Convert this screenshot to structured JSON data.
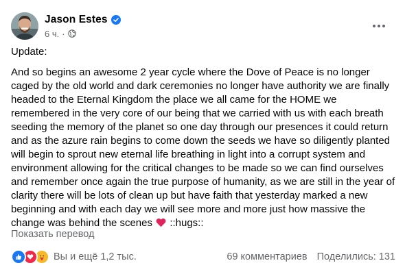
{
  "post": {
    "author": "Jason Estes",
    "time": "6 ч.",
    "separator": "·",
    "update_label": "Update:",
    "body_before_heart": "And so begins an awesome 2 year cycle where the Dove of Peace is no longer caged by the old world and dark ceremonies no longer have authority we are finally headed to the Eternal Kingdom the place we all came for the HOME we remembered in the very core of our being that we carried with us with each breath seeding the memory of the planet so one day through our presences it could return and as the azure rain begins to come down the seeds we have so diligently planted will begin to sprout new eternal life breathing in light into a corrupt system and environment allowing for the critical changes to be made so we can find ourselves and remember once again the true purpose of humanity, as we are still in the year of clarity there will be lots of clean up but have faith that yesterday marked a new beginning and with each day we will see more and more just how massive the change was behind the scenes",
    "body_after_heart": " ::hugs::",
    "translate_label": "Показать перевод",
    "icons": {
      "verified": "verified-badge-icon",
      "privacy": "globe-icon",
      "more": "more-options-icon",
      "heart": "red-heart-emoji"
    }
  },
  "engagement": {
    "reactions_text": "Вы и ещё 1,2 тыс.",
    "comments_text": "69 комментариев",
    "shares_text": "Поделились: 131",
    "reaction_types": [
      "like",
      "love",
      "care"
    ]
  },
  "colors": {
    "text_primary": "#050505",
    "text_secondary": "#65676b",
    "brand_blue": "#1877f2",
    "love_red": "#f0284a",
    "care_yellow": "#f7b928"
  }
}
